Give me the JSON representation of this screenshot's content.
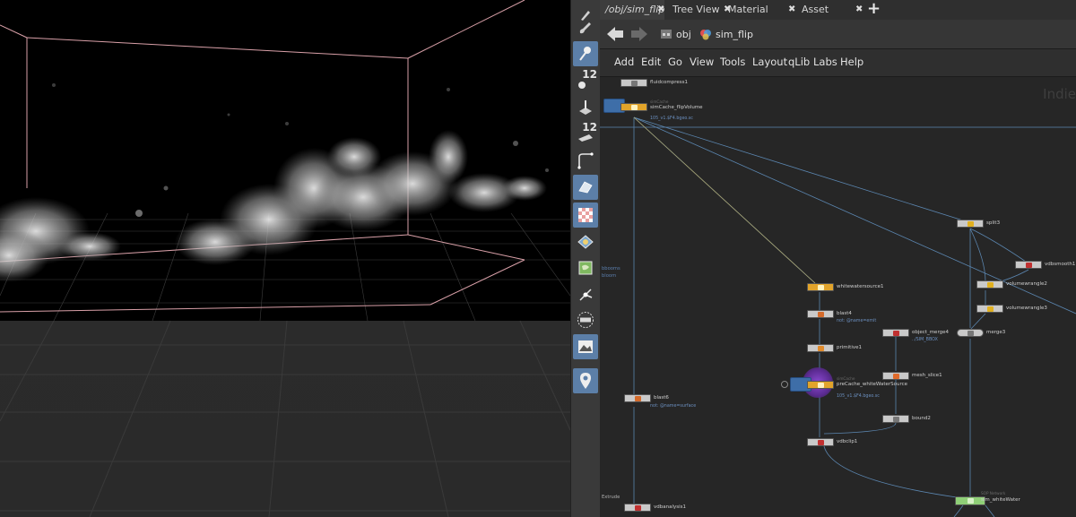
{
  "tabs": [
    {
      "label": "/obj/sim_flip",
      "active": true
    },
    {
      "label": "Tree View"
    },
    {
      "label": "Material Palette"
    },
    {
      "label": "Asset Browser"
    }
  ],
  "tab_close": "✖",
  "tab_add": "+",
  "path": {
    "items": [
      "obj",
      "sim_flip"
    ]
  },
  "menu": [
    "Add",
    "Edit",
    "Go",
    "View",
    "Tools",
    "Layout",
    "qLib",
    "Labs",
    "Help"
  ],
  "toolbar": {
    "num_a": "12",
    "num_b": "12"
  },
  "watermark": "Indie",
  "canvas_texts": {
    "booms": "bbooms",
    "bloom": "bloom",
    "extrude": "Extrude",
    "nocache": "noCache",
    "nocache2": "noCache",
    "sop_network": "SOP Network"
  },
  "nodes": {
    "fluidcompress1": {
      "label": "fluidcompress1"
    },
    "simcache_flipvolume": {
      "label": "simCache_flipVolume",
      "sub": "105_v1.$F4.bgeo.sc",
      "cap": "simCache"
    },
    "whitewatersource1": {
      "label": "whitewatersource1"
    },
    "blast4": {
      "label": "blast4",
      "sub": "not: @name=emit"
    },
    "primitive1": {
      "label": "primitive1"
    },
    "precache_whitewatersource": {
      "label": "preCache_whiteWaterSource",
      "sub": "105_v1.$F4.bgeo.sc",
      "cap": "simCache"
    },
    "object_merge4": {
      "label": "object_merge4",
      "sub": "../SIM_BBOX"
    },
    "mesh_slice1": {
      "label": "mesh_slice1"
    },
    "bound2": {
      "label": "bound2"
    },
    "vdbclip1": {
      "label": "vdbclip1"
    },
    "blast6": {
      "label": "blast6",
      "sub": "not: @name=surface"
    },
    "vdbanalysis1": {
      "label": "vdbanalysis1"
    },
    "split3": {
      "label": "split3"
    },
    "vdbsmooth1": {
      "label": "vdbsmooth1"
    },
    "volumewrangle2": {
      "label": "volumewrangle2"
    },
    "volumewrangle3": {
      "label": "volumewrangle3"
    },
    "merge3": {
      "label": "merge3"
    },
    "sim_whitewater": {
      "label": "sim_whiteWater",
      "cap": "SOP Network"
    }
  },
  "colors": {
    "accent": "#5c7fa8",
    "cache": "#e2a42a",
    "sop": "#8fcf77",
    "wire": "#5b86b0",
    "bbox": "#d9a0a8"
  }
}
